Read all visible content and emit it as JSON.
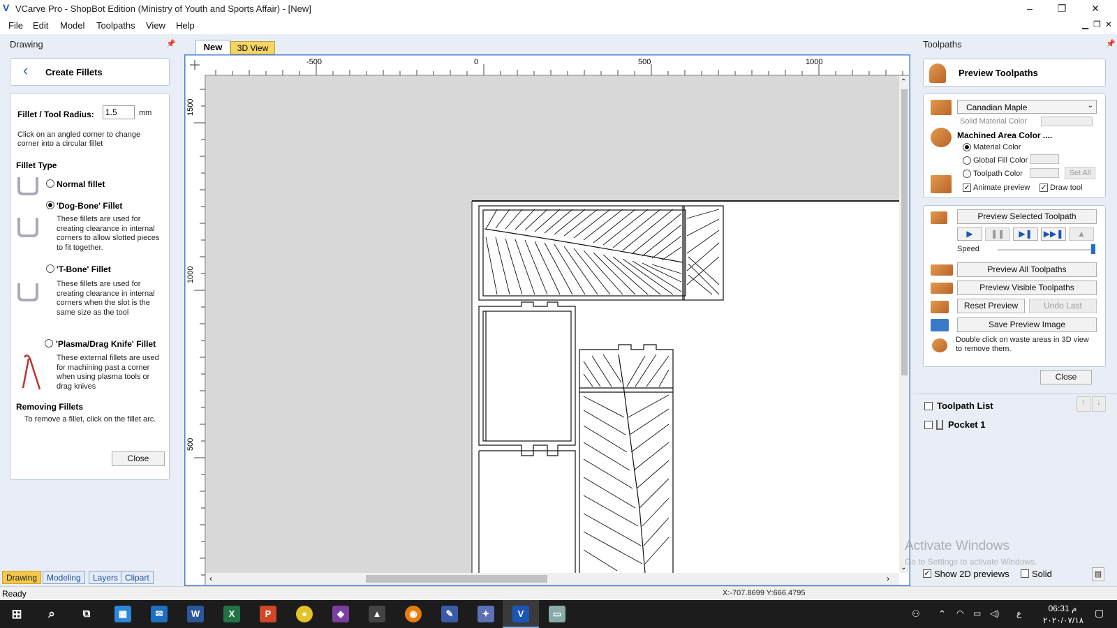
{
  "window": {
    "title": "VCarve Pro - ShopBot Edition (Ministry of Youth and Sports Affair) - [New]",
    "controls": [
      "–",
      "❐",
      "✕"
    ]
  },
  "menu": {
    "items": [
      "File",
      "Edit",
      "Model",
      "Toolpaths",
      "View",
      "Help"
    ]
  },
  "left_panel": {
    "header": "Drawing",
    "title": "Create Fillets",
    "radius_label": "Fillet / Tool Radius:",
    "radius_value": "1.5",
    "radius_unit": "mm",
    "instruction": "Click on an angled corner to change corner into a circular fillet",
    "fillet_type_heading": "Fillet Type",
    "options": [
      {
        "label": "Normal fillet",
        "selected": false,
        "desc": ""
      },
      {
        "label": "'Dog-Bone' Fillet",
        "selected": true,
        "desc": "These fillets are used for creating clearance in internal corners to allow slotted pieces to fit together."
      },
      {
        "label": "'T-Bone' Fillet",
        "selected": false,
        "desc": "These fillets are used for creating clearance in internal corners when the slot is the same size as the tool"
      },
      {
        "label": "'Plasma/Drag Knife' Fillet",
        "selected": false,
        "desc": "These external fillets are used for machining past a corner when using plasma tools or drag knives"
      }
    ],
    "removing_heading": "Removing Fillets",
    "removing_text": "To remove a fillet, click on the fillet arc.",
    "close_label": "Close",
    "bottom_tabs": [
      "Drawing",
      "Modeling",
      "Layers",
      "Clipart"
    ]
  },
  "center": {
    "tabs": [
      "New",
      "3D View"
    ],
    "ruler_h_labels": [
      "-500",
      "0",
      "500",
      "1000"
    ],
    "ruler_v_labels": [
      "1500",
      "1000",
      "500"
    ]
  },
  "right_panel": {
    "header": "Toolpaths",
    "title": "Preview Toolpaths",
    "material": "Canadian Maple",
    "solid_material_color": "Solid Material Color",
    "machined_area": "Machined Area Color ....",
    "color_options": [
      {
        "label": "Material Color",
        "selected": true
      },
      {
        "label": "Global Fill Color",
        "selected": false
      },
      {
        "label": "Toolpath Color",
        "selected": false
      }
    ],
    "set_all": "Set All",
    "animate_preview": "Animate preview",
    "draw_tool": "Draw tool",
    "preview_selected": "Preview Selected Toolpath",
    "speed_label": "Speed",
    "speed_level": 1.0,
    "preview_all": "Preview All Toolpaths",
    "preview_visible": "Preview Visible Toolpaths",
    "reset_preview": "Reset Preview",
    "undo_last": "Undo Last",
    "save_image": "Save Preview Image",
    "hint": "Double click on waste areas in 3D view to remove them.",
    "close_label": "Close",
    "toolpath_list_label": "Toolpath List",
    "toolpaths": [
      "Pocket 1"
    ],
    "show_2d_previews": "Show 2D previews",
    "solid": "Solid"
  },
  "watermark": {
    "line1": "Activate Windows",
    "line2": "Go to Settings to activate Windows."
  },
  "status": {
    "text": "Ready",
    "coords": "X:-707.8699 Y:666.4795"
  },
  "taskbar": {
    "time": "06:31 م",
    "date": "٢٠٢٠/٠٧/١٨",
    "lang": "ع"
  },
  "colors": {
    "accent": "#1c6fd6",
    "panel_bg": "#e9eef6",
    "canvas_bg": "#d8d8d8",
    "orange": "#d9843a"
  }
}
